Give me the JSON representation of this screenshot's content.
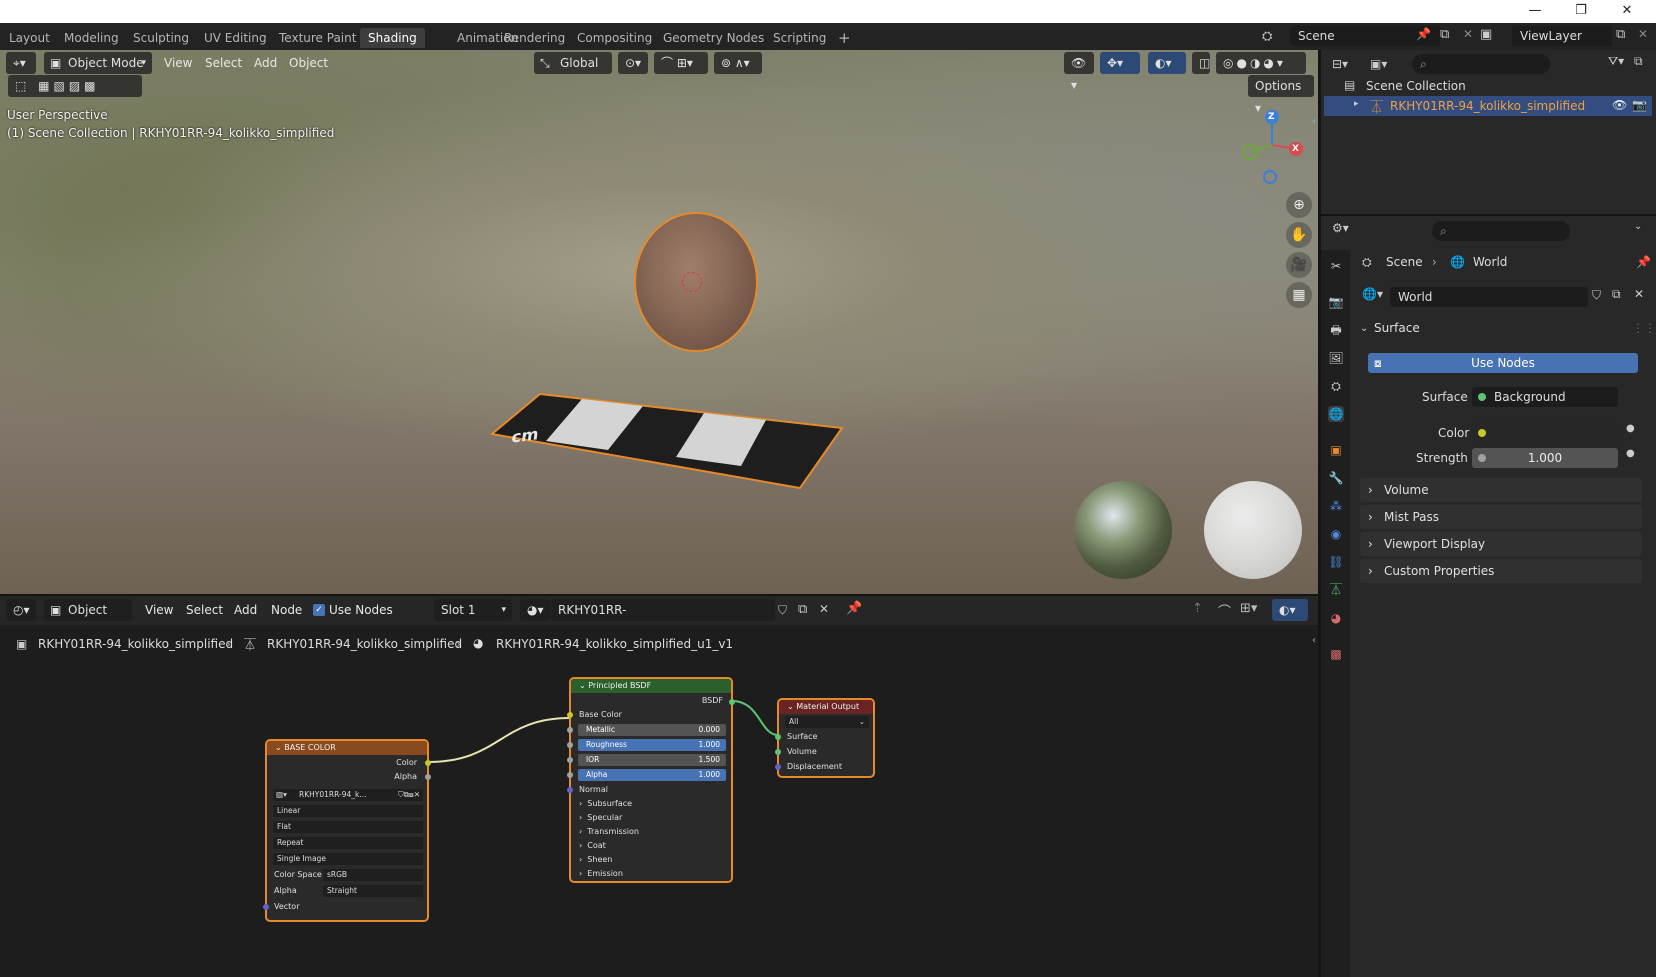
{
  "window": {
    "minimize": "—",
    "maximize": "❐",
    "close": "✕"
  },
  "workspaces": [
    "Layout",
    "Modeling",
    "Sculpting",
    "UV Editing",
    "Texture Paint",
    "Shading",
    "Animation",
    "Rendering",
    "Compositing",
    "Geometry Nodes",
    "Scripting",
    "+"
  ],
  "active_workspace": "Shading",
  "scene_field": "Scene",
  "viewlayer_field": "ViewLayer",
  "viewport": {
    "mode": "Object Mode",
    "menus": [
      "View",
      "Select",
      "Add",
      "Object"
    ],
    "transform": "Global",
    "options": "Options",
    "perspective": "User Perspective",
    "collection_line": "(1) Scene Collection | RKHY01RR-94_kolikko_simplified",
    "gizmo": {
      "z": "Z",
      "x": "X"
    },
    "ruler_label": "cm"
  },
  "outliner": {
    "root": "Scene Collection",
    "item": "RKHY01RR-94_kolikko_simplified"
  },
  "properties": {
    "breadcrumb": [
      "Scene",
      "World"
    ],
    "world_name": "World",
    "surface_panel": "Surface",
    "use_nodes": "Use Nodes",
    "surface_label": "Surface",
    "surface_value": "Background",
    "color_label": "Color",
    "strength_label": "Strength",
    "strength_value": "1.000",
    "collapsed_panels": [
      "Volume",
      "Mist Pass",
      "Viewport Display",
      "Custom Properties"
    ]
  },
  "node_editor": {
    "type": "Object",
    "menus": [
      "View",
      "Select",
      "Add",
      "Node"
    ],
    "use_nodes": "Use Nodes",
    "slot": "Slot 1",
    "material": "RKHY01RR-94_kolikko_simplified_u1_v1",
    "breadcrumb": [
      "RKHY01RR-94_kolikko_simplified",
      "RKHY01RR-94_kolikko_simplified",
      "RKHY01RR-94_kolikko_simplified_u1_v1"
    ]
  },
  "nodes": {
    "image": {
      "title": "BASE COLOR",
      "out_color": "Color",
      "out_alpha": "Alpha",
      "image_name": "RKHY01RR-94_k...",
      "interpolation": "Linear",
      "projection": "Flat",
      "extension": "Repeat",
      "source": "Single Image",
      "color_space_label": "Color Space",
      "color_space": "sRGB",
      "alpha_label": "Alpha",
      "alpha_mode": "Straight",
      "vector": "Vector"
    },
    "bsdf": {
      "title": "Principled BSDF",
      "out": "BSDF",
      "base_color": "Base Color",
      "metallic": "Metallic",
      "metallic_v": "0.000",
      "roughness": "Roughness",
      "roughness_v": "1.000",
      "ior": "IOR",
      "ior_v": "1.500",
      "alpha": "Alpha",
      "alpha_v": "1.000",
      "normal": "Normal",
      "sections": [
        "Subsurface",
        "Specular",
        "Transmission",
        "Coat",
        "Sheen",
        "Emission"
      ]
    },
    "output": {
      "title": "Material Output",
      "target": "All",
      "surface": "Surface",
      "volume": "Volume",
      "displacement": "Displacement"
    }
  },
  "colors": {
    "accent": "#4772b3",
    "selected_orange": "#e58a2a",
    "bsdf_header": "#2b5f2b",
    "image_header": "#8a4a1f",
    "output_header": "#6a2424"
  }
}
